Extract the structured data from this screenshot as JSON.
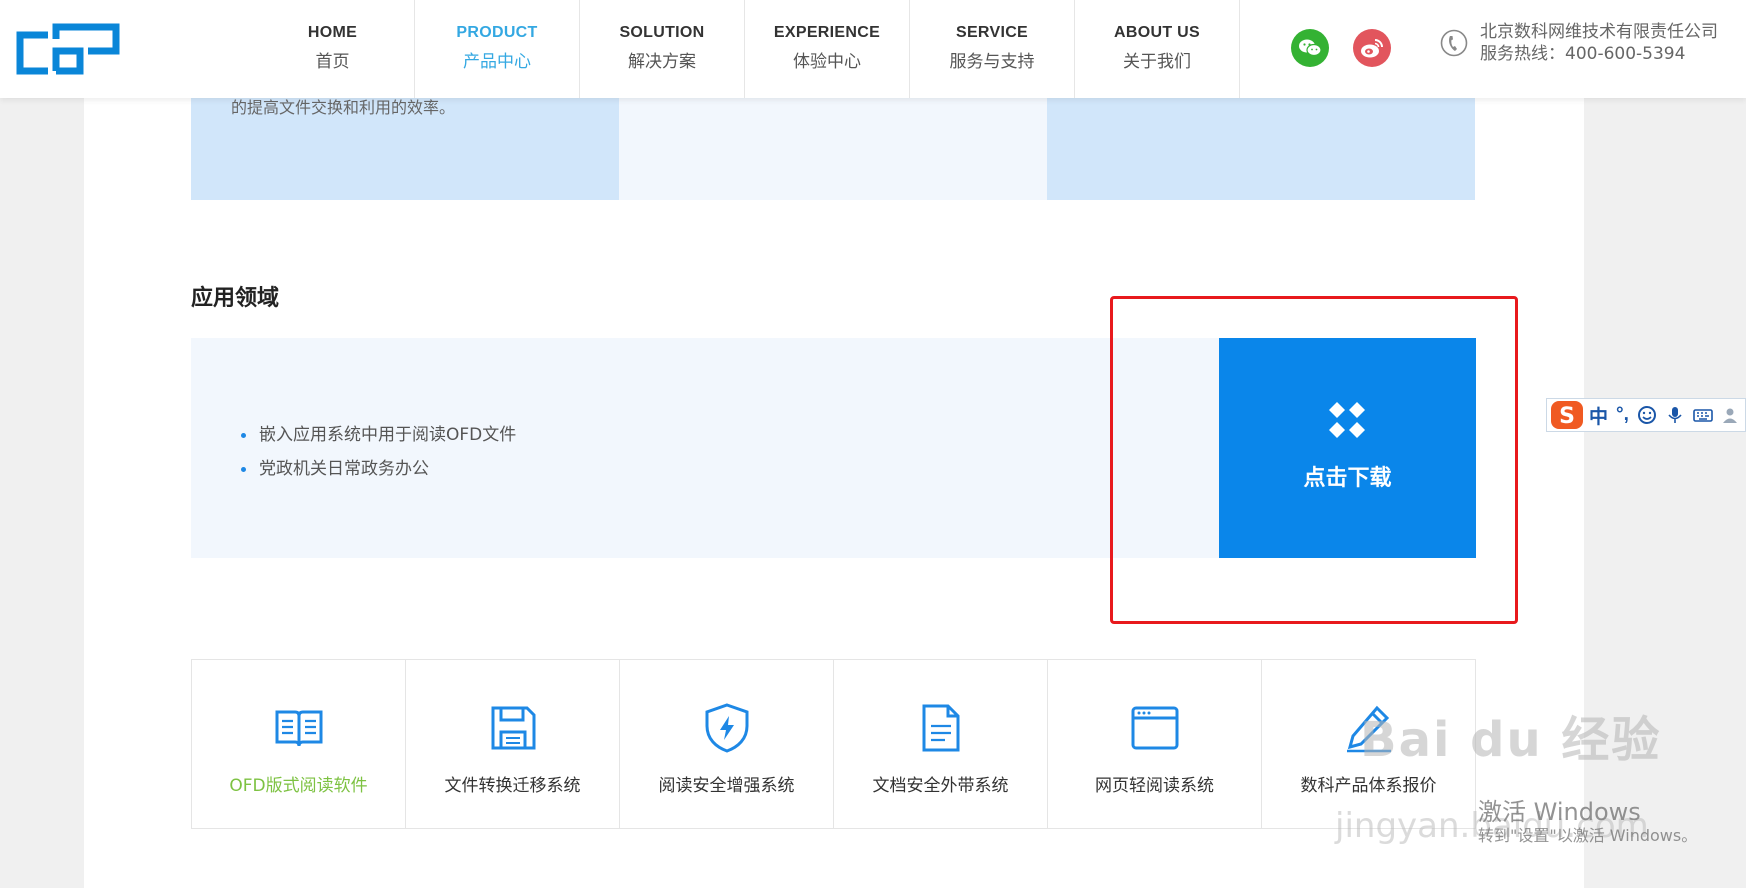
{
  "header": {
    "logo_icon": "csp-logo-icon",
    "nav": [
      {
        "en": "HOME",
        "cn": "首页"
      },
      {
        "en": "PRODUCT",
        "cn": "产品中心"
      },
      {
        "en": "SOLUTION",
        "cn": "解决方案"
      },
      {
        "en": "EXPERIENCE",
        "cn": "体验中心"
      },
      {
        "en": "SERVICE",
        "cn": "服务与支持"
      },
      {
        "en": "ABOUT US",
        "cn": "关于我们"
      }
    ],
    "active_nav": "PRODUCT",
    "social_icons": [
      "wechat-icon",
      "weibo-icon"
    ],
    "company_name": "北京数科网维技术有限责任公司",
    "hotline": "服务热线：400-600-5394"
  },
  "top_cards": {
    "text": "的提高文件交换和利用的效率。"
  },
  "application": {
    "title": "应用领域",
    "items": [
      "嵌入应用系统中用于阅读OFD文件",
      "党政机关日常政务办公"
    ],
    "download_label": "点击下载"
  },
  "products": [
    {
      "label": "OFD版式阅读软件",
      "icon": "open-book-icon"
    },
    {
      "label": "文件转换迁移系统",
      "icon": "floppy-disk-icon"
    },
    {
      "label": "阅读安全增强系统",
      "icon": "shield-bolt-icon"
    },
    {
      "label": "文档安全外带系统",
      "icon": "document-icon"
    },
    {
      "label": "网页轻阅读系统",
      "icon": "browser-window-icon"
    },
    {
      "label": "数科产品体系报价",
      "icon": "pen-icon"
    }
  ],
  "ime_toolbar": {
    "mode": "中",
    "punct": "°,"
  },
  "watermark": {
    "brand": "Bai du 经验",
    "url": "jingyan.baidu.com"
  },
  "windows_activation": {
    "title": "激活 Windows",
    "subtitle": "转到\"设置\"以激活 Windows。"
  },
  "colors": {
    "accent": "#34a8e2",
    "download_bg": "#0a86ea",
    "highlight": "#e8191d",
    "active_product": "#7dc242"
  }
}
